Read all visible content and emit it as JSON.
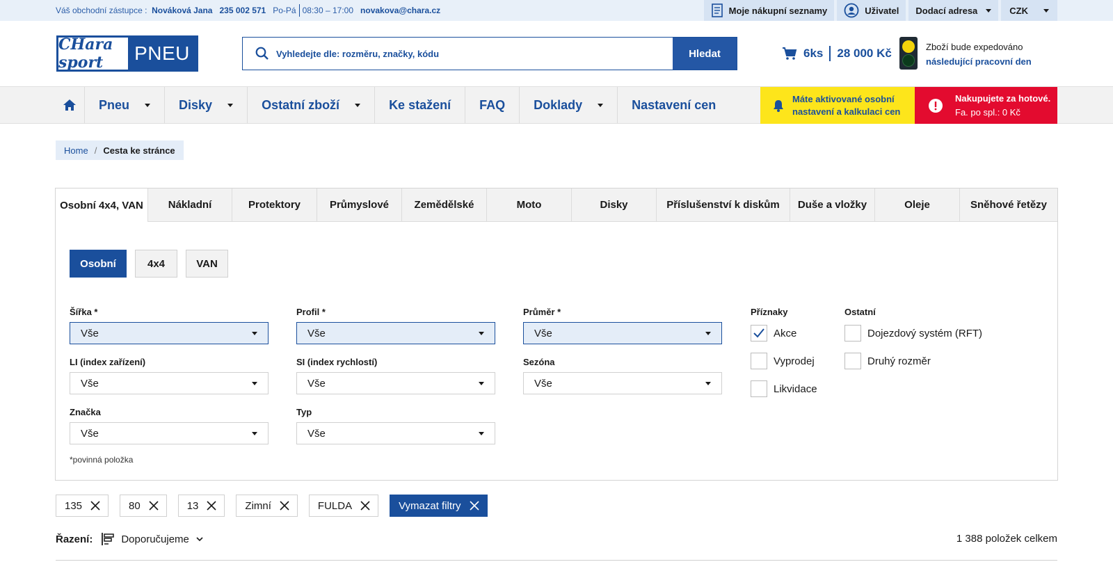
{
  "topbar": {
    "rep_label": "Váš obchodní zástupce :",
    "rep_name": "Nováková Jana",
    "rep_phone": "235 002 571",
    "rep_days": "Po-Pá",
    "rep_hours": "08:30 – 17:00",
    "rep_email": "novakova@chara.cz",
    "shopping_lists": "Moje nákupní seznamy",
    "user": "Uživatel",
    "delivery": "Dodací adresa",
    "currency": "CZK"
  },
  "header": {
    "logo_left": "CHara sport",
    "logo_right": "PNEU",
    "search_placeholder": "Vyhledejte dle: rozměru, značky, kódu",
    "search_button": "Hledat",
    "cart_qty": "6ks",
    "cart_total": "28 000 Kč",
    "ship_line1": "Zboží bude expedováno",
    "ship_line2": "následující pracovní den"
  },
  "nav": {
    "items": [
      "Pneu",
      "Disky",
      "Ostatní zboží",
      "Ke stažení",
      "FAQ",
      "Doklady",
      "Nastavení cen"
    ],
    "alert_yellow_1": "Máte aktivované osobní",
    "alert_yellow_2": "nastavení a kalkulaci cen",
    "alert_red_1": "Nakupujete za hotové.",
    "alert_red_2": "Fa. po spl.: 0 Kč"
  },
  "breadcrumb": {
    "home": "Home",
    "current": "Cesta ke stránce"
  },
  "tabs": [
    "Osobní 4x4, VAN",
    "Nákladní",
    "Protektory",
    "Průmyslové",
    "Zemědělské",
    "Moto",
    "Disky",
    "Příslušenství k diskům",
    "Duše a vložky",
    "Oleje",
    "Sněhové řetězy"
  ],
  "subtabs": [
    "Osobní",
    "4x4",
    "VAN"
  ],
  "filters": {
    "width_label": "Šířka *",
    "profile_label": "Profil *",
    "diameter_label": "Průměr *",
    "li_label": "LI (index zařízení)",
    "si_label": "SI (index rychlostí)",
    "season_label": "Sezóna",
    "brand_label": "Značka",
    "type_label": "Typ",
    "all": "Vše",
    "flags_label": "Příznaky",
    "other_label": "Ostatní",
    "flag_akce": "Akce",
    "flag_vyprodej": "Vyprodej",
    "flag_likvidace": "Likvidace",
    "other_rft": "Dojezdový systém (RFT)",
    "other_second": "Druhý rozměr",
    "required_note": "*povinná položka"
  },
  "chips": [
    "135",
    "80",
    "13",
    "Zimní",
    "FULDA"
  ],
  "clear_filters": "Vymazat filtry",
  "sort": {
    "label": "Řazení:",
    "value": "Doporučujeme",
    "total": "1 388 položek celkem"
  },
  "colors": {
    "brand_blue": "#1a4f9c",
    "alert_yellow": "#fde51b",
    "alert_red": "#e30b2f"
  }
}
